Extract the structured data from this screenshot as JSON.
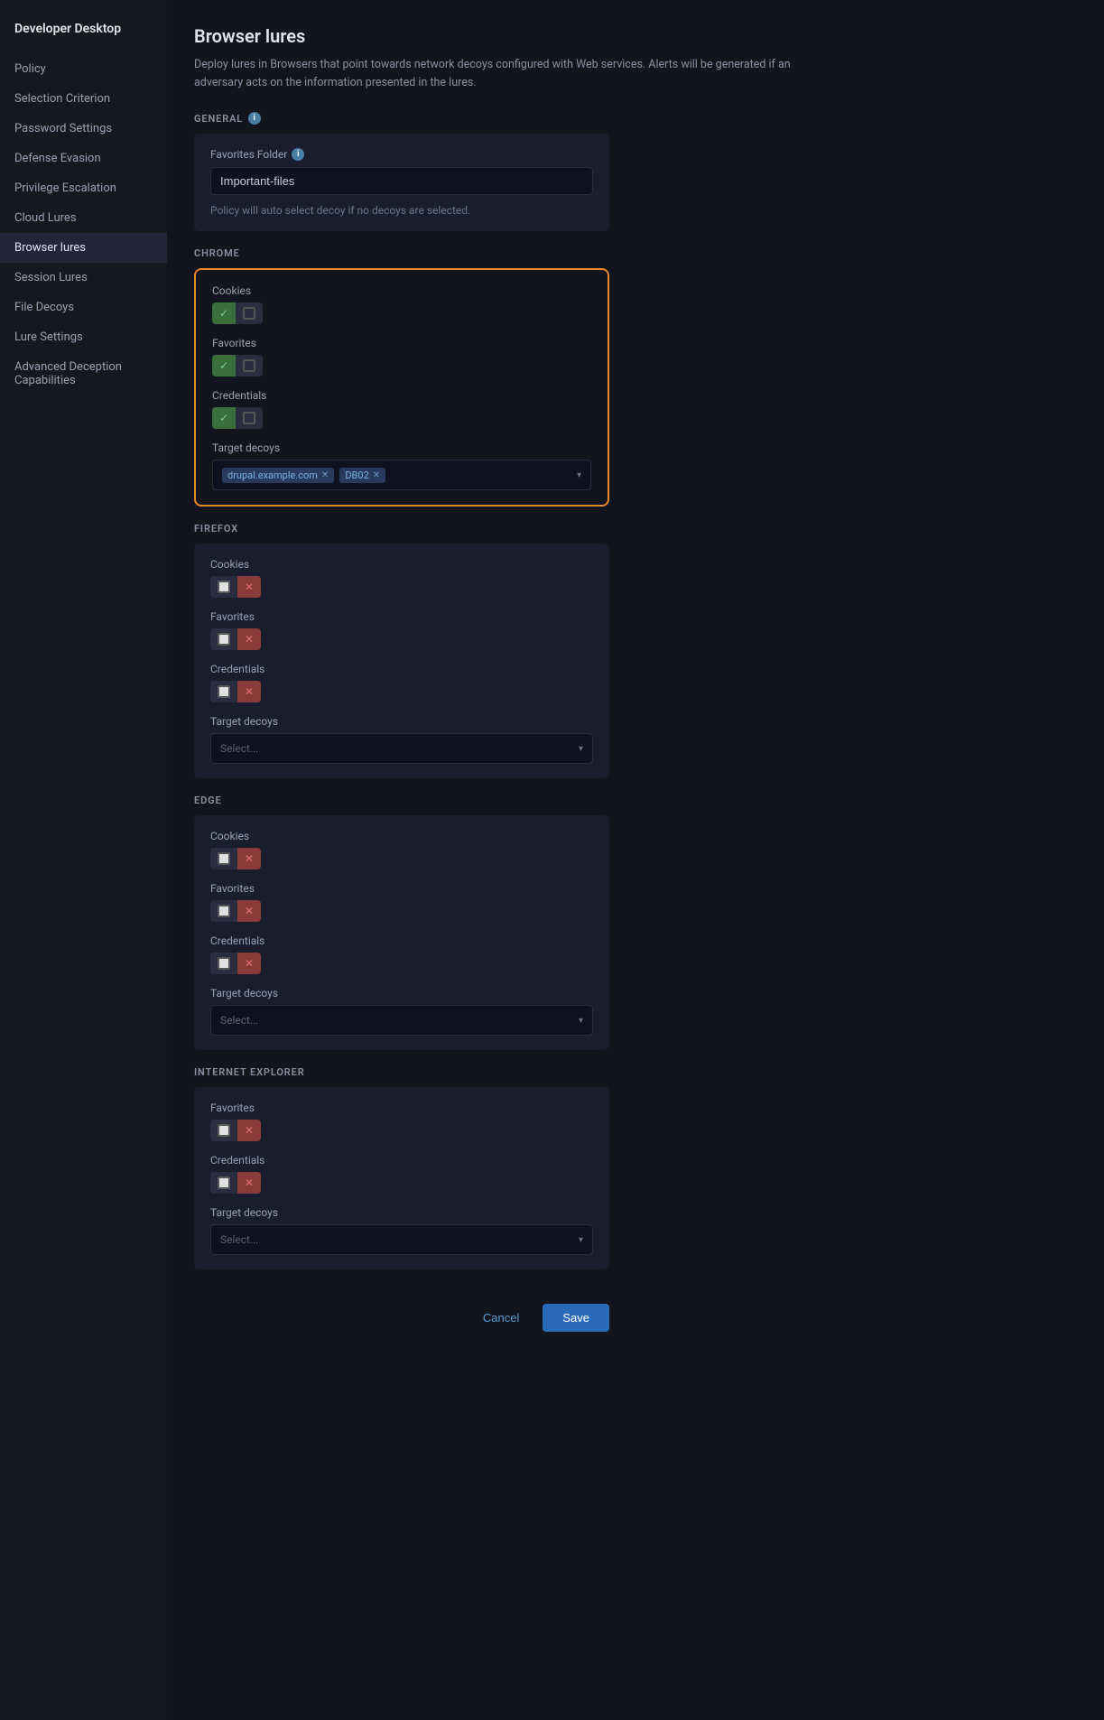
{
  "app": {
    "title": "Developer Desktop"
  },
  "sidebar": {
    "items": [
      {
        "id": "policy",
        "label": "Policy",
        "active": false
      },
      {
        "id": "selection-criterion",
        "label": "Selection Criterion",
        "active": false
      },
      {
        "id": "password-settings",
        "label": "Password Settings",
        "active": false
      },
      {
        "id": "defense-evasion",
        "label": "Defense Evasion",
        "active": false
      },
      {
        "id": "privilege-escalation",
        "label": "Privilege Escalation",
        "active": false
      },
      {
        "id": "cloud-lures",
        "label": "Cloud Lures",
        "active": false
      },
      {
        "id": "browser-lures",
        "label": "Browser lures",
        "active": true
      },
      {
        "id": "session-lures",
        "label": "Session Lures",
        "active": false
      },
      {
        "id": "file-decoys",
        "label": "File Decoys",
        "active": false
      },
      {
        "id": "lure-settings",
        "label": "Lure Settings",
        "active": false
      },
      {
        "id": "advanced-deception",
        "label": "Advanced Deception Capabilities",
        "active": false
      }
    ]
  },
  "main": {
    "title": "Browser lures",
    "description": "Deploy lures in Browsers that point towards network decoys configured with Web services. Alerts will be generated if an adversary acts on the information presented in the lures.",
    "general": {
      "label": "GENERAL",
      "favorites_folder_label": "Favorites Folder",
      "favorites_folder_value": "Important-files",
      "auto_select_note": "Policy will auto select decoy if no decoys are selected."
    },
    "chrome": {
      "section_label": "CHROME",
      "cookies_label": "Cookies",
      "cookies_enabled": true,
      "favorites_label": "Favorites",
      "favorites_enabled": true,
      "credentials_label": "Credentials",
      "credentials_enabled": true,
      "target_decoys_label": "Target decoys",
      "target_decoys": [
        {
          "id": "drupal",
          "label": "drupal.example.com"
        },
        {
          "id": "db02",
          "label": "DB02"
        }
      ],
      "select_placeholder": ""
    },
    "firefox": {
      "section_label": "FIREFOX",
      "cookies_label": "Cookies",
      "cookies_enabled": false,
      "favorites_label": "Favorites",
      "favorites_enabled": false,
      "credentials_label": "Credentials",
      "credentials_enabled": false,
      "target_decoys_label": "Target decoys",
      "select_placeholder": "Select..."
    },
    "edge": {
      "section_label": "EDGE",
      "cookies_label": "Cookies",
      "cookies_enabled": false,
      "favorites_label": "Favorites",
      "favorites_enabled": false,
      "credentials_label": "Credentials",
      "credentials_enabled": false,
      "target_decoys_label": "Target decoys",
      "select_placeholder": "Select..."
    },
    "ie": {
      "section_label": "INTERNET EXPLORER",
      "favorites_label": "Favorites",
      "favorites_enabled": false,
      "credentials_label": "Credentials",
      "credentials_enabled": false,
      "target_decoys_label": "Target decoys",
      "select_placeholder": "Select..."
    }
  },
  "footer": {
    "cancel_label": "Cancel",
    "save_label": "Save"
  }
}
